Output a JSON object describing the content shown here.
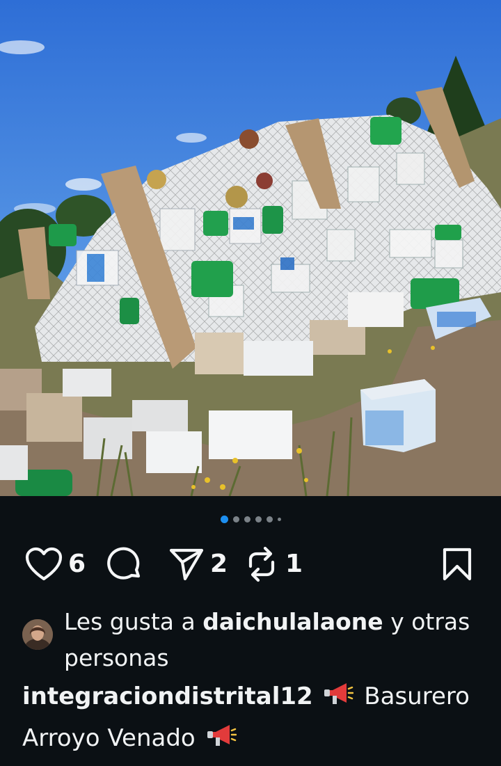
{
  "post": {
    "carousel": {
      "total_dots": 6,
      "active_index": 0
    },
    "actions": {
      "like_count": "6",
      "share_count": "2",
      "repost_count": "1"
    },
    "liked_by": {
      "prefix": "Les gusta a",
      "username": "daichulalaone",
      "suffix": "y otras personas"
    },
    "caption": {
      "username": "integraciondistrital12",
      "emoji_1": "📢",
      "text": "Basurero Arroyo Venado",
      "emoji_2": "📢"
    }
  },
  "colors": {
    "background": "#0b1014",
    "active_dot": "#1d8ff0",
    "inactive_dot": "#7b8288",
    "text": "#f1f3f4"
  },
  "icons": [
    "heart-icon",
    "comment-icon",
    "share-icon",
    "repost-icon",
    "bookmark-icon",
    "megaphone-icon"
  ]
}
